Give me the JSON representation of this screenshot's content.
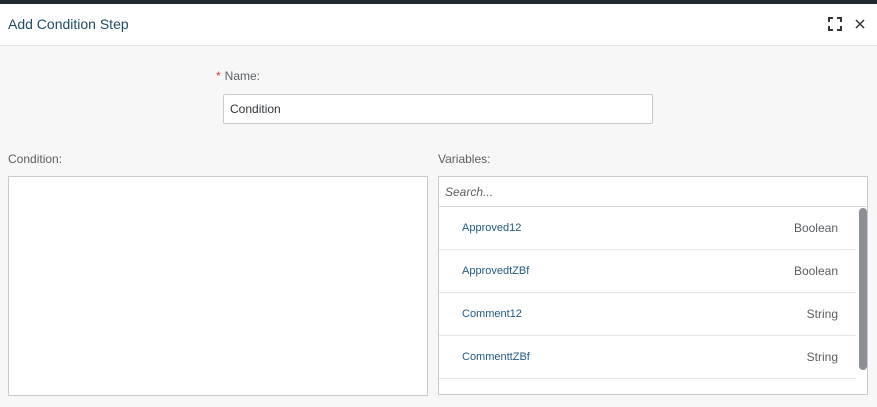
{
  "dialog": {
    "title": "Add Condition Step"
  },
  "form": {
    "required_marker": "*",
    "name_label": "Name:",
    "name_value": "Condition",
    "condition_label": "Condition:",
    "condition_value": "",
    "variables_label": "Variables:",
    "search_placeholder": "Search..."
  },
  "variables": [
    {
      "name": "Approved12",
      "type": "Boolean"
    },
    {
      "name": "ApprovedtZBf",
      "type": "Boolean"
    },
    {
      "name": "Comment12",
      "type": "String"
    },
    {
      "name": "CommenttZBf",
      "type": "String"
    }
  ],
  "icons": {
    "expand": "expand-icon",
    "close": "close-icon"
  },
  "colors": {
    "title": "#1f4b66",
    "variable_name": "#1f5a85",
    "required": "#e0393e"
  }
}
